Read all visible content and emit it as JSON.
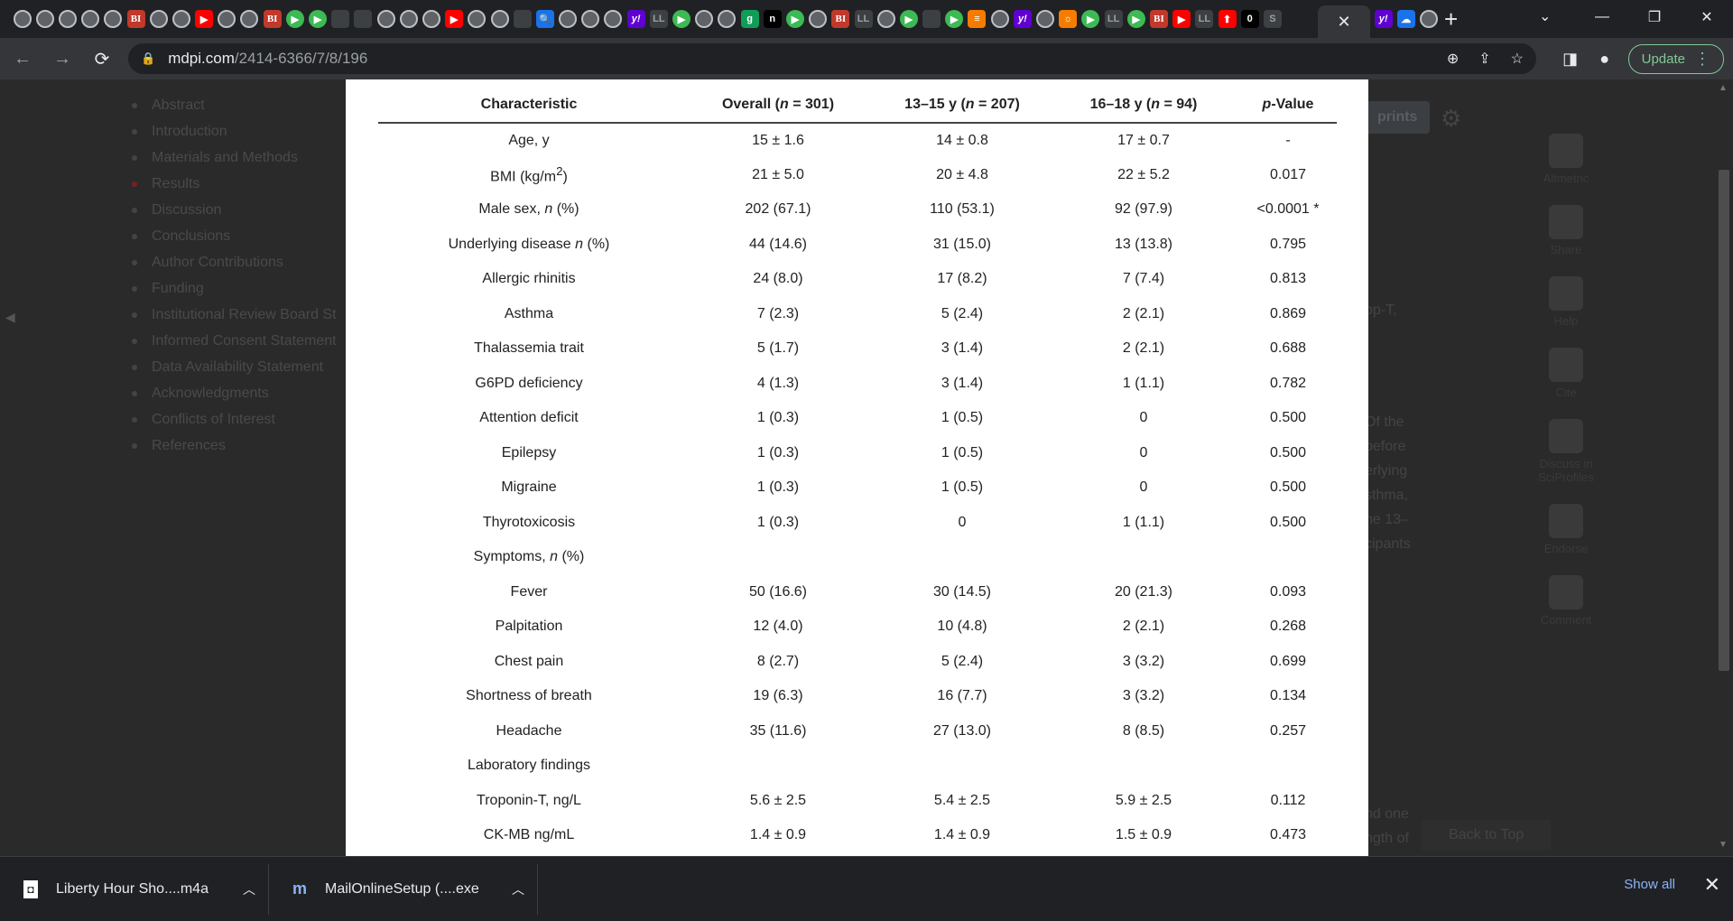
{
  "browser": {
    "tab_icons": [
      {
        "kind": "globe",
        "glyph": ""
      },
      {
        "kind": "globe",
        "glyph": ""
      },
      {
        "kind": "globe",
        "glyph": ""
      },
      {
        "kind": "globe",
        "glyph": ""
      },
      {
        "kind": "globe",
        "glyph": ""
      },
      {
        "kind": "bi",
        "glyph": "BI"
      },
      {
        "kind": "globe",
        "glyph": ""
      },
      {
        "kind": "globe",
        "glyph": ""
      },
      {
        "kind": "yt",
        "glyph": "▶"
      },
      {
        "kind": "globe",
        "glyph": ""
      },
      {
        "kind": "globe",
        "glyph": ""
      },
      {
        "kind": "bi",
        "glyph": "BI"
      },
      {
        "kind": "play",
        "glyph": "▶"
      },
      {
        "kind": "play",
        "glyph": "▶"
      },
      {
        "kind": "gray",
        "glyph": ""
      },
      {
        "kind": "gray",
        "glyph": ""
      },
      {
        "kind": "globe",
        "glyph": ""
      },
      {
        "kind": "globe",
        "glyph": ""
      },
      {
        "kind": "globe",
        "glyph": ""
      },
      {
        "kind": "yt",
        "glyph": "▶"
      },
      {
        "kind": "globe",
        "glyph": ""
      },
      {
        "kind": "globe",
        "glyph": ""
      },
      {
        "kind": "gray",
        "glyph": ""
      },
      {
        "kind": "blue",
        "glyph": "🔍"
      },
      {
        "kind": "globe",
        "glyph": ""
      },
      {
        "kind": "globe",
        "glyph": ""
      },
      {
        "kind": "globe",
        "glyph": ""
      },
      {
        "kind": "yahoo",
        "glyph": "y!"
      },
      {
        "kind": "gray",
        "glyph": "LL"
      },
      {
        "kind": "play",
        "glyph": "▶"
      },
      {
        "kind": "globe",
        "glyph": ""
      },
      {
        "kind": "globe",
        "glyph": ""
      },
      {
        "kind": "green",
        "glyph": "g"
      },
      {
        "kind": "dark",
        "glyph": "n"
      },
      {
        "kind": "play",
        "glyph": "▶"
      },
      {
        "kind": "globe",
        "glyph": ""
      },
      {
        "kind": "bi",
        "glyph": "BI"
      },
      {
        "kind": "gray",
        "glyph": "LL"
      },
      {
        "kind": "globe",
        "glyph": ""
      },
      {
        "kind": "play",
        "glyph": "▶"
      },
      {
        "kind": "gray",
        "glyph": ""
      },
      {
        "kind": "play",
        "glyph": "▶"
      },
      {
        "kind": "orange",
        "glyph": "≡"
      },
      {
        "kind": "globe",
        "glyph": ""
      },
      {
        "kind": "yahoo",
        "glyph": "y!"
      },
      {
        "kind": "globe",
        "glyph": ""
      },
      {
        "kind": "orange",
        "glyph": "☼"
      },
      {
        "kind": "play",
        "glyph": "▶"
      },
      {
        "kind": "gray",
        "glyph": "LL"
      },
      {
        "kind": "play",
        "glyph": "▶"
      },
      {
        "kind": "bi",
        "glyph": "BI"
      },
      {
        "kind": "yt",
        "glyph": "▶"
      },
      {
        "kind": "gray",
        "glyph": "LL"
      },
      {
        "kind": "yt",
        "glyph": "⬆"
      },
      {
        "kind": "dark",
        "glyph": "0"
      },
      {
        "kind": "gray",
        "glyph": "S"
      }
    ],
    "active_tab_icons": [
      {
        "kind": "yahoo",
        "glyph": "y!"
      },
      {
        "kind": "blue",
        "glyph": "☁"
      },
      {
        "kind": "globe",
        "glyph": ""
      }
    ],
    "url_host": "mdpi.com",
    "url_path": "/2414-6366/7/8/196",
    "update_label": "Update"
  },
  "page": {
    "toc": [
      "Abstract",
      "Introduction",
      "Materials and Methods",
      "Results",
      "Discussion",
      "Conclusions",
      "Author Contributions",
      "Funding",
      "Institutional Review Board St",
      "Informed Consent Statement",
      "Data Availability Statement",
      "Acknowledgments",
      "Conflicts of Interest",
      "References"
    ],
    "toc_active_index": 3,
    "prints_label": "prints",
    "side_actions": [
      "Altmetric",
      "Share",
      "Help",
      "Cite",
      "Discuss in SciProfiles",
      "Endorse",
      "Comment"
    ],
    "bg_text_top": "op-T,",
    "bg_text_mid": [
      "Of the",
      "before",
      "erlying",
      "sthma,",
      "he 13–",
      "cipants"
    ],
    "bg_text_bottom": [
      "nd one",
      "ngth of"
    ],
    "back_to_top": "Back to Top"
  },
  "table": {
    "headers": [
      "Characteristic",
      "Overall (n = 301)",
      "13–15 y (n = 207)",
      "16–18 y (n = 94)",
      "p-Value"
    ],
    "rows": [
      [
        "Age, y",
        "15 ± 1.6",
        "14 ± 0.8",
        "17 ± 0.7",
        "-"
      ],
      [
        "BMI (kg/m2)",
        "21 ± 5.0",
        "20 ± 4.8",
        "22 ± 5.2",
        "0.017"
      ],
      [
        "Male sex, n (%)",
        "202 (67.1)",
        "110 (53.1)",
        "92 (97.9)",
        "<0.0001 *"
      ],
      [
        "Underlying disease n (%)",
        "44 (14.6)",
        "31 (15.0)",
        "13 (13.8)",
        "0.795"
      ],
      [
        "Allergic rhinitis",
        "24 (8.0)",
        "17 (8.2)",
        "7 (7.4)",
        "0.813"
      ],
      [
        "Asthma",
        "7 (2.3)",
        "5 (2.4)",
        "2 (2.1)",
        "0.869"
      ],
      [
        "Thalassemia trait",
        "5 (1.7)",
        "3 (1.4)",
        "2 (2.1)",
        "0.688"
      ],
      [
        "G6PD deficiency",
        "4 (1.3)",
        "3 (1.4)",
        "1 (1.1)",
        "0.782"
      ],
      [
        "Attention deficit",
        "1 (0.3)",
        "1 (0.5)",
        "0",
        "0.500"
      ],
      [
        "Epilepsy",
        "1 (0.3)",
        "1 (0.5)",
        "0",
        "0.500"
      ],
      [
        "Migraine",
        "1 (0.3)",
        "1 (0.5)",
        "0",
        "0.500"
      ],
      [
        "Thyrotoxicosis",
        "1 (0.3)",
        "0",
        "1 (1.1)",
        "0.500"
      ],
      [
        "Symptoms, n (%)",
        "",
        "",
        "",
        ""
      ],
      [
        "Fever",
        "50 (16.6)",
        "30 (14.5)",
        "20 (21.3)",
        "0.093"
      ],
      [
        "Palpitation",
        "12 (4.0)",
        "10 (4.8)",
        "2 (2.1)",
        "0.268"
      ],
      [
        "Chest pain",
        "8 (2.7)",
        "5 (2.4)",
        "3 (3.2)",
        "0.699"
      ],
      [
        "Shortness of breath",
        "19 (6.3)",
        "16 (7.7)",
        "3 (3.2)",
        "0.134"
      ],
      [
        "Headache",
        "35 (11.6)",
        "27 (13.0)",
        "8 (8.5)",
        "0.257"
      ],
      [
        "Laboratory findings",
        "",
        "",
        "",
        ""
      ],
      [
        "Troponin-T, ng/L",
        "5.6 ± 2.5",
        "5.4 ± 2.5",
        "5.9 ± 2.5",
        "0.112"
      ],
      [
        "CK-MB ng/mL",
        "1.4 ± 0.9",
        "1.4 ± 0.9",
        "1.5 ± 0.9",
        "0.473"
      ]
    ]
  },
  "downloads": {
    "items": [
      {
        "name": "Liberty Hour Sho....m4a",
        "icon": "file-icon"
      },
      {
        "name": "MailOnlineSetup (....exe",
        "icon": "mailonline-icon"
      }
    ],
    "show_all": "Show all"
  }
}
